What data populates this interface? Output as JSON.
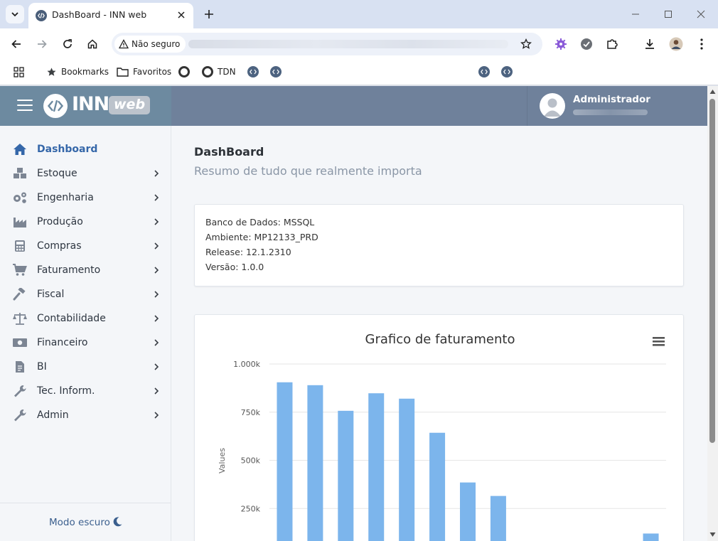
{
  "browser": {
    "tab_title": "DashBoard - INN web",
    "security_label": "Não seguro",
    "bookmarks": {
      "bookmarks_label": "Bookmarks",
      "favoritos_label": "Favoritos",
      "tdn_label": "TDN"
    }
  },
  "app": {
    "logo_text": "INN",
    "logo_badge": "web",
    "user_name": "Administrador"
  },
  "sidebar": {
    "items": [
      {
        "label": "Dashboard",
        "icon": "home-icon"
      },
      {
        "label": "Estoque",
        "icon": "cubes-icon"
      },
      {
        "label": "Engenharia",
        "icon": "cogs-icon"
      },
      {
        "label": "Produção",
        "icon": "industry-icon"
      },
      {
        "label": "Compras",
        "icon": "calculator-icon"
      },
      {
        "label": "Faturamento",
        "icon": "cart-icon"
      },
      {
        "label": "Fiscal",
        "icon": "gavel-icon"
      },
      {
        "label": "Contabilidade",
        "icon": "balance-scale-icon"
      },
      {
        "label": "Financeiro",
        "icon": "money-icon"
      },
      {
        "label": "BI",
        "icon": "file-icon"
      },
      {
        "label": "Tec. Inform.",
        "icon": "wrench-icon"
      },
      {
        "label": "Admin",
        "icon": "wrench-icon"
      }
    ],
    "dark_mode_label": "Modo escuro"
  },
  "main": {
    "title": "DashBoard",
    "subtitle": "Resumo de tudo que realmente importa",
    "info": {
      "db": "Banco de Dados: MSSQL",
      "env": "Ambiente: MP12133_PRD",
      "release": "Release: 12.1.2310",
      "version": "Versão: 1.0.0"
    }
  },
  "chart_data": {
    "type": "bar",
    "title": "Grafico de faturamento",
    "ylabel": "Values",
    "xlabel": "",
    "ylim": [
      0,
      1000000
    ],
    "yticks": [
      250000,
      500000,
      750000,
      1000000
    ],
    "ytick_labels": [
      "250k",
      "500k",
      "750k",
      "1.000k"
    ],
    "values": [
      905000,
      890000,
      757000,
      848000,
      820000,
      643000,
      385000,
      315000,
      0,
      0,
      0,
      0,
      120000
    ],
    "grid": true,
    "bar_color": "#7cb5ec"
  }
}
